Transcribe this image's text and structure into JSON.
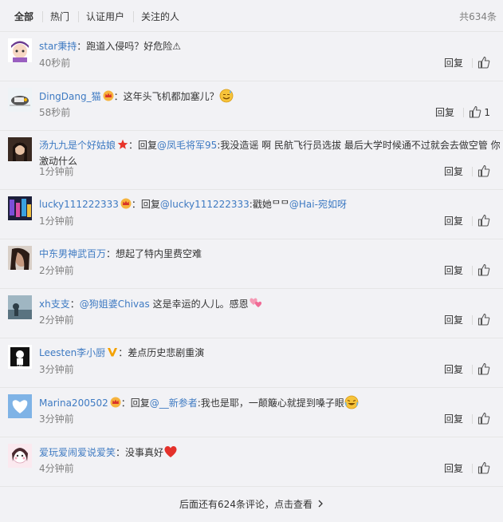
{
  "tabs": [
    {
      "label": "全部",
      "active": true
    },
    {
      "label": "热门",
      "active": false
    },
    {
      "label": "认证用户",
      "active": false
    },
    {
      "label": "关注的人",
      "active": false
    }
  ],
  "total": "共634条",
  "reply_label": "回复",
  "comments": [
    {
      "user": "star秉持",
      "sep": "：",
      "prefix": "",
      "mention": "",
      "text": "跑道入侵吗？好危险⚠",
      "time": "40秒前",
      "likes": ""
    },
    {
      "user": "DingDang_猫",
      "sep": "：",
      "prefix": "",
      "mention": "",
      "text": "这年头飞机都加塞儿？",
      "time": "58秒前",
      "likes": "1"
    },
    {
      "user": "汤九九是个好姑娘",
      "sep": "：",
      "prefix": "回复",
      "mention": "@凤毛将军95",
      "text": ":我没造谣 啊 民航飞行员选拔 最后大学时候通不过就会去做空管 你激动什么",
      "time": "1分钟前",
      "likes": ""
    },
    {
      "user": "lucky111222333",
      "sep": "：",
      "prefix": "回复",
      "mention": "@lucky111222333",
      "text": ":戳她ᄆᄆ",
      "mention2": "@Hai-宛如呀",
      "time": "1分钟前",
      "likes": ""
    },
    {
      "user": "中东男神武百万",
      "sep": "：",
      "prefix": "",
      "mention": "",
      "text": "想起了特内里费空难",
      "time": "2分钟前",
      "likes": ""
    },
    {
      "user": "xh支支",
      "sep": "：",
      "prefix": "",
      "mention": "@狗姐婆Chivas",
      "text": " 这是幸运的人儿。感恩",
      "time": "2分钟前",
      "likes": ""
    },
    {
      "user": "Leesten李小厨",
      "sep": "：",
      "prefix": "",
      "mention": "",
      "text": "差点历史悲剧重演",
      "time": "3分钟前",
      "likes": ""
    },
    {
      "user": "Marina200502",
      "sep": "：",
      "prefix": "回复",
      "mention": "@__新参者",
      "text": ":我也是耶，一颠簸心就提到嗓子眼",
      "time": "3分钟前",
      "likes": ""
    },
    {
      "user": "爱玩爱闹爱说爱笑",
      "sep": "：",
      "prefix": "",
      "mention": "",
      "text": "没事真好",
      "time": "4分钟前",
      "likes": ""
    }
  ],
  "more": "后面还有624条评论，点击查看"
}
